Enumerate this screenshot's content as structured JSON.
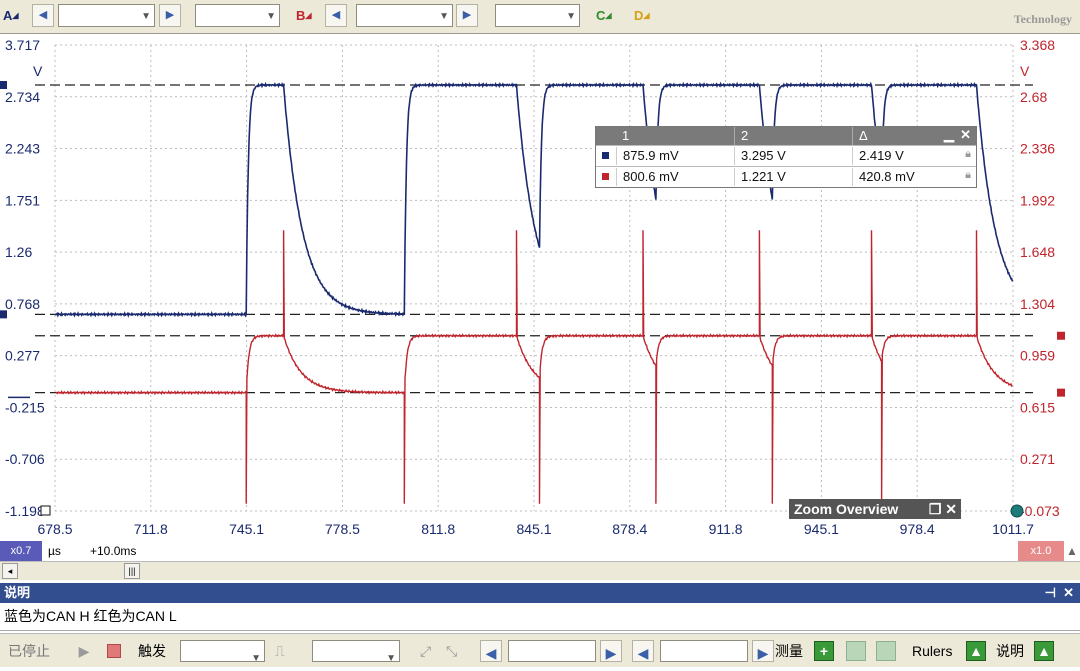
{
  "toolbar": {
    "channels": [
      {
        "label": "A",
        "color": "#1a2a6e"
      },
      {
        "label": "B",
        "color": "#c0252e"
      },
      {
        "label": "C",
        "color": "#2e8b2e"
      },
      {
        "label": "D",
        "color": "#d4a017"
      }
    ],
    "logo_text": "Technology"
  },
  "chart_data": {
    "type": "line",
    "x_ticks": [
      "678.5",
      "711.8",
      "745.1",
      "778.5",
      "811.8",
      "845.1",
      "878.4",
      "911.8",
      "945.1",
      "978.4",
      "1011.7"
    ],
    "x_unit": "µs",
    "x_offset": "+10.0ms",
    "x_zoom_left": "x0.7",
    "x_zoom_right": "x1.0",
    "left_axis": {
      "ticks": [
        "3.717",
        "2.734",
        "2.243",
        "1.751",
        "1.26",
        "0.768",
        "0.277",
        "-0.215",
        "-0.706",
        "-1.198"
      ],
      "unit": "V",
      "color": "#1a2a6e",
      "ylim": [
        -1.198,
        3.717
      ]
    },
    "right_axis": {
      "ticks": [
        "3.368",
        "2.68",
        "2.336",
        "1.992",
        "1.648",
        "1.304",
        "0.959",
        "0.615",
        "0.271",
        "-0.073"
      ],
      "unit": "V",
      "color": "#c0252e",
      "ylim": [
        -0.073,
        3.368
      ]
    },
    "series": [
      {
        "color": "#1a2a6e",
        "axis": "left",
        "low": 0.876,
        "high": 3.295,
        "transitions": [
          {
            "x": 745.0,
            "type": "rise"
          },
          {
            "x": 758.0,
            "type": "fall"
          },
          {
            "x": 800.0,
            "type": "rise"
          },
          {
            "x": 839.0,
            "type": "fall"
          },
          {
            "x": 847.0,
            "type": "rise"
          },
          {
            "x": 883.0,
            "type": "fall"
          },
          {
            "x": 887.5,
            "type": "rise"
          },
          {
            "x": 923.5,
            "type": "fall"
          },
          {
            "x": 928.0,
            "type": "rise"
          },
          {
            "x": 962.5,
            "type": "fall"
          },
          {
            "x": 966.0,
            "type": "rise"
          },
          {
            "x": 999.0,
            "type": "fall"
          }
        ]
      },
      {
        "color": "#c0252e",
        "axis": "right",
        "low": 0.801,
        "high": 1.221,
        "events": [
          {
            "x": 745.0,
            "type": "dip"
          },
          {
            "x": 758.0,
            "type": "spike"
          },
          {
            "x": 800.0,
            "type": "dip"
          },
          {
            "x": 839.0,
            "type": "spike"
          },
          {
            "x": 847.0,
            "type": "dip"
          },
          {
            "x": 883.0,
            "type": "spike"
          },
          {
            "x": 887.5,
            "type": "dip"
          },
          {
            "x": 923.5,
            "type": "spike"
          },
          {
            "x": 928.0,
            "type": "dip"
          },
          {
            "x": 962.5,
            "type": "spike"
          },
          {
            "x": 966.0,
            "type": "dip"
          },
          {
            "x": 999.0,
            "type": "spike"
          }
        ]
      }
    ],
    "grid": true
  },
  "measurements": {
    "headers": [
      "1",
      "2",
      "Δ"
    ],
    "rows": [
      {
        "color": "#1a2a6e",
        "v1": "875.9 mV",
        "v2": "3.295 V",
        "delta": "2.419 V"
      },
      {
        "color": "#c0252e",
        "v1": "800.6 mV",
        "v2": "1.221 V",
        "delta": "420.8 mV"
      }
    ]
  },
  "zoom_overview": {
    "title": "Zoom Overview"
  },
  "description": {
    "title": "说明",
    "text": "蓝色为CAN H    红色为CAN L"
  },
  "bottombar": {
    "stop_label": "已停止",
    "trigger_label": "触发",
    "measure_label": "测量",
    "rulers_label": "Rulers",
    "notes_label": "说明"
  }
}
